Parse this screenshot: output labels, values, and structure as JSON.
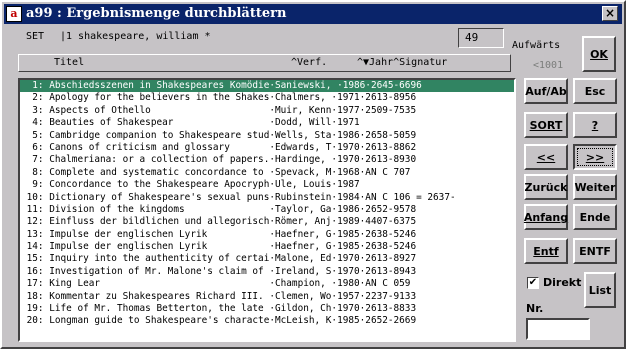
{
  "window": {
    "app_icon": "a99-logo",
    "title": "a99 : Ergebnismenge durchblättern",
    "close_label": "×"
  },
  "set": {
    "label": "SET",
    "query": "|1 shakespeare, william *",
    "count": "49"
  },
  "nav": {
    "direction_label": "Aufwärts",
    "history_ref": "<1001"
  },
  "table": {
    "headers": {
      "title": "Titel",
      "author": "^Verf.",
      "year": "^▼Jahr^Signatur"
    },
    "rows": [
      "  1: Abschiedsszenen in Shakespeares Komödie·Saniewski, ·1986·2645-6696",
      "  2: Apology for the believers in the Shakes·Chalmers, ·1971·2613-8956",
      "  3: Aspects of Othello                     ·Muir, Kenn·1977·2509-7535",
      "  4: Beauties of Shakespear                 ·Dodd, Will·1971",
      "  5: Cambridge companion to Shakespeare stud·Wells, Sta·1986·2658-5059",
      "  6: Canons of criticism and glossary       ·Edwards, T·1970·2613-8862",
      "  7: Chalmeriana: or a collection of papers.·Hardinge, ·1970·2613-8930",
      "  8: Complete and systematic concordance to ·Spevack, M·1968·AN C 707",
      "  9: Concordance to the Shakespeare Apocryph·Ule, Louis·1987",
      " 10: Dictionary of Shakespeare's sexual puns·Rubinstein·1984·AN C 106 = 2637-",
      " 11: Division of the kingdoms               ·Taylor, Ga·1986·2652-9578",
      " 12: Einfluss der bildlichen und allegorisch·Römer, Anj·1989·4407-6375",
      " 13: Impulse der englischen Lyrik           ·Haefner, G·1985·2638-5246",
      " 14: Impulse der englischen Lyrik           ·Haefner, G·1985·2638-5246",
      " 15: Inquiry into the authenticity of certai·Malone, Ed·1970·2613-8927",
      " 16: Investigation of Mr. Malone's claim of ·Ireland, S·1970·2613-8943",
      " 17: King Lear                              ·Champion, ·1980·AN C 059",
      " 18: Kommentar zu Shakespeares Richard III. ·Clemen, Wo·1957·2237-9133",
      " 19: Life of Mr. Thomas Betterton, the late ·Gildon, Ch·1970·2613-8833",
      " 20: Longman guide to Shakespeare's characte·McLeish, K·1985·2652-2669"
    ]
  },
  "buttons": {
    "ok": "OK",
    "auf_ab": "Auf/Ab",
    "esc": "Esc",
    "sort": "SORT",
    "help": "?",
    "prev": "<<",
    "next": ">>",
    "zurueck": "Zurück",
    "weiter": "Weiter",
    "anfang": "Anfang",
    "ende": "Ende",
    "entf": "Entf",
    "entf_caps": "ENTF",
    "list": "List"
  },
  "direkt": {
    "label": "Direkt",
    "checked": true,
    "mark": "✔"
  },
  "nr": {
    "label": "Nr.",
    "value": ""
  }
}
